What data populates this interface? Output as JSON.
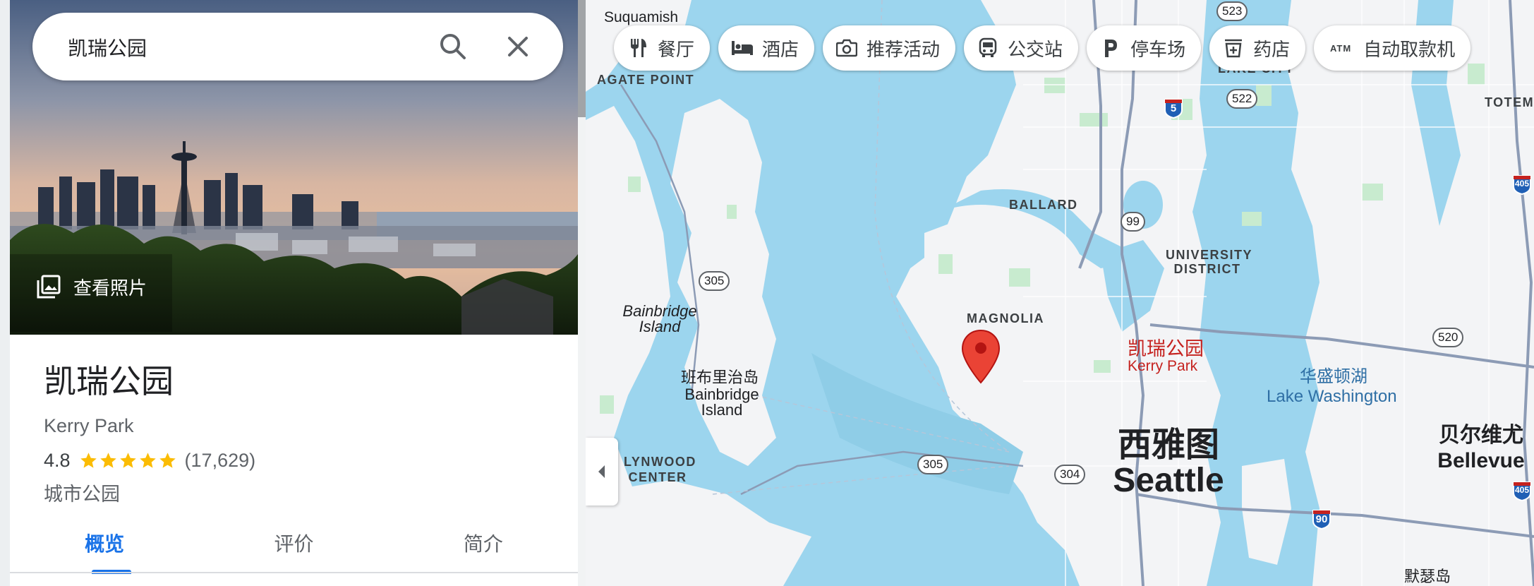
{
  "search": {
    "value": "凯瑞公园"
  },
  "hero": {
    "view_photos_label": "查看照片"
  },
  "place": {
    "title": "凯瑞公园",
    "subtitle": "Kerry Park",
    "rating": "4.8",
    "stars": 5,
    "review_count": "(17,629)",
    "category": "城市公园"
  },
  "tabs": [
    {
      "label": "概览",
      "active": true
    },
    {
      "label": "评价",
      "active": false
    },
    {
      "label": "简介",
      "active": false
    }
  ],
  "chips": [
    {
      "label": "餐厅",
      "icon": "restaurant-icon"
    },
    {
      "label": "酒店",
      "icon": "hotel-icon"
    },
    {
      "label": "推荐活动",
      "icon": "camera-icon"
    },
    {
      "label": "公交站",
      "icon": "bus-icon"
    },
    {
      "label": "停车场",
      "icon": "parking-icon"
    },
    {
      "label": "药店",
      "icon": "pharmacy-icon"
    },
    {
      "label": "自动取款机",
      "icon": "atm-icon",
      "icon_text": "ATM"
    }
  ],
  "map": {
    "labels": {
      "suquamish": "Suquamish",
      "agate_point": "AGATE POINT",
      "lake_city": "LAKE CITY",
      "totem": "TOTEM",
      "ballard": "BALLARD",
      "university_district": "UNIVERSITY DISTRICT",
      "magnolia": "MAGNOLIA",
      "bainbridge_en": "Bainbridge Island",
      "bainbridge_zh": "班布里治岛",
      "bainbridge_en2": "Bainbridge Island",
      "lynwood_center": "LYNWOOD CENTER",
      "lake_washington_zh": "华盛顿湖",
      "lake_washington_en": "Lake Washington",
      "seattle_zh": "西雅图",
      "seattle_en": "Seattle",
      "bellevue_zh": "贝尔维尤",
      "bellevue_en": "Bellevue",
      "medina_zh": "默瑟岛",
      "place_zh": "凯瑞公园",
      "place_en": "Kerry Park"
    },
    "route_shields": [
      "523",
      "522",
      "99",
      "305",
      "520",
      "305",
      "304"
    ],
    "interstates": [
      "5",
      "405",
      "90",
      "405"
    ]
  },
  "colors": {
    "water": "#9cd5ee",
    "land": "#f3f4f6",
    "park": "#c8ebcf",
    "accent": "#1a73e8",
    "pin": "#ea4335",
    "star": "#fbbc04"
  }
}
